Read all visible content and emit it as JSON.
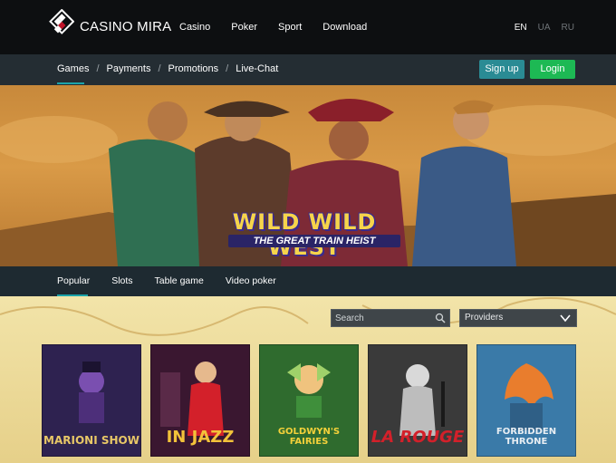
{
  "brand": {
    "name": "CASINO MIRA"
  },
  "main_nav": [
    "Casino",
    "Poker",
    "Sport",
    "Download"
  ],
  "languages": [
    {
      "code": "EN",
      "active": true
    },
    {
      "code": "UA",
      "active": false
    },
    {
      "code": "RU",
      "active": false
    }
  ],
  "sub_nav": [
    "Games",
    "Payments",
    "Promotions",
    "Live-Chat"
  ],
  "auth": {
    "signup_label": "Sign up",
    "login_label": "Login"
  },
  "banner": {
    "title": "WILD WILD WEST",
    "subtitle": "THE GREAT TRAIN HEIST"
  },
  "categories": [
    "Popular",
    "Slots",
    "Table game",
    "Video poker"
  ],
  "search": {
    "placeholder": "Search"
  },
  "providers": {
    "label": "Providers"
  },
  "games": [
    {
      "title": "MARIONI SHOW",
      "bg": "#2e2250",
      "fg": "#e8c767"
    },
    {
      "title": "IN JAZZ",
      "bg": "#3a1730",
      "fg": "#f2c23a"
    },
    {
      "title": "GOLDWYN'S FAIRIES",
      "bg": "#2f6b2e",
      "fg": "#f4d13a"
    },
    {
      "title": "LA ROUGE",
      "bg": "#3a3a3a",
      "fg": "#d3202a"
    },
    {
      "title": "FORBIDDEN THRONE",
      "bg": "#3a7aa8",
      "fg": "#e8eef3"
    }
  ],
  "colors": {
    "accent": "#1ba3a9",
    "login": "#1db954",
    "signup": "#2a8b94"
  }
}
